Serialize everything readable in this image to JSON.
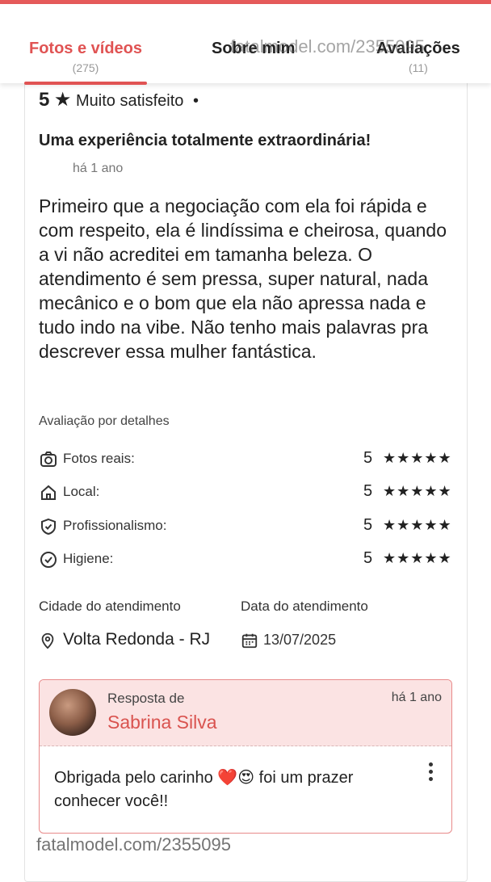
{
  "tabs": [
    {
      "label": "Fotos e vídeos",
      "count": "(275)",
      "active": true
    },
    {
      "label": "Sobre mim",
      "count": ""
    },
    {
      "label": "Avaliações",
      "count": "(11)"
    }
  ],
  "watermark": "fatalmodel.com/2355095",
  "review": {
    "rating": "5",
    "rating_text": "Muito satisfeito",
    "separator": "•",
    "title": "Uma experiência totalmente extraordinária!",
    "time": "há 1 ano",
    "body": "Primeiro que a negociação com ela foi rápida e com respeito, ela é lindíssima e cheirosa, quando a vi não acreditei em tamanha beleza. O atendimento é sem pressa, super natural, nada mecânico e o bom que ela não apressa nada e tudo indo na vibe. Não tenho mais palavras pra descrever essa mulher fantástica."
  },
  "details": {
    "title": "Avaliação por detalhes",
    "rows": [
      {
        "icon": "camera-icon",
        "label": "Fotos reais:",
        "score": "5",
        "stars": "★★★★★"
      },
      {
        "icon": "home-icon",
        "label": "Local:",
        "score": "5",
        "stars": "★★★★★"
      },
      {
        "icon": "shield-check-icon",
        "label": "Profissionalismo:",
        "score": "5",
        "stars": "★★★★★"
      },
      {
        "icon": "check-circle-icon",
        "label": "Higiene:",
        "score": "5",
        "stars": "★★★★★"
      }
    ]
  },
  "service": {
    "city_label": "Cidade do atendimento",
    "city": "Volta Redonda - RJ",
    "date_label": "Data do atendimento",
    "date": "13/07/2025"
  },
  "reply": {
    "label": "Resposta de",
    "name": "Sabrina Silva",
    "time": "há 1 ano",
    "text": "Obrigada pelo carinho ❤️😍 foi um prazer conhecer você!!"
  },
  "colors": {
    "accent": "#e05353",
    "reply_bg": "#fbe3e3"
  }
}
